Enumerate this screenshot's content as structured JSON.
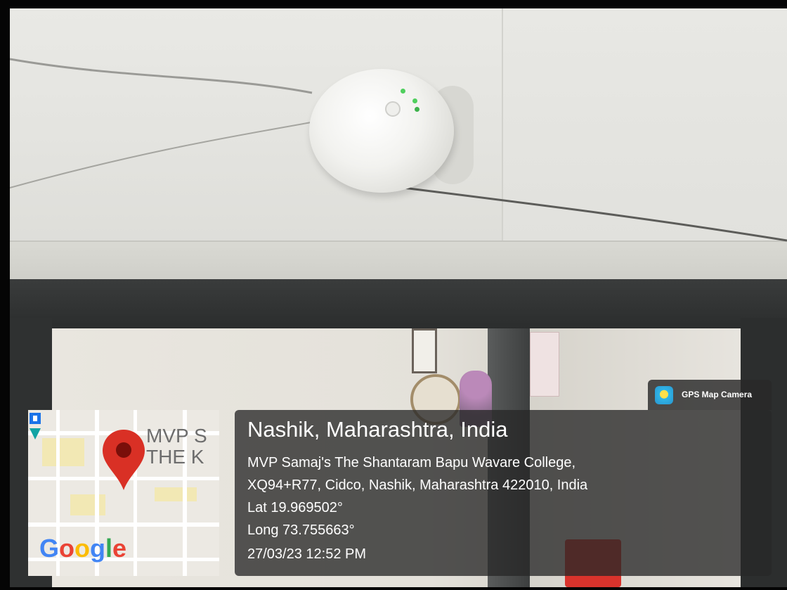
{
  "map": {
    "label": "MVP S\nTHE K",
    "logo": "Google",
    "logo_letters": [
      "G",
      "o",
      "o",
      "g",
      "l",
      "e"
    ],
    "logo_colors": [
      "#4285F4",
      "#EA4335",
      "#FBBC05",
      "#4285F4",
      "#34A853",
      "#EA4335"
    ],
    "marker_icon": "map-pin-icon",
    "nav_icon": "navigation-arrow-icon"
  },
  "badge": {
    "label": "GPS Map Camera",
    "icon": "gps-map-camera-icon"
  },
  "location": {
    "place": "Nashik, Maharashtra, India",
    "address_line1": "MVP Samaj's The Shantaram Bapu Wavare College,",
    "address_line2": "XQ94+R77, Cidco, Nashik, Maharashtra 422010, India",
    "lat": "Lat 19.969502°",
    "long": "Long 73.755663°",
    "datetime": "27/03/23 12:52 PM"
  },
  "colors": {
    "card_bg": "#282828",
    "marker_red": "#d93025",
    "text": "#ffffff"
  }
}
